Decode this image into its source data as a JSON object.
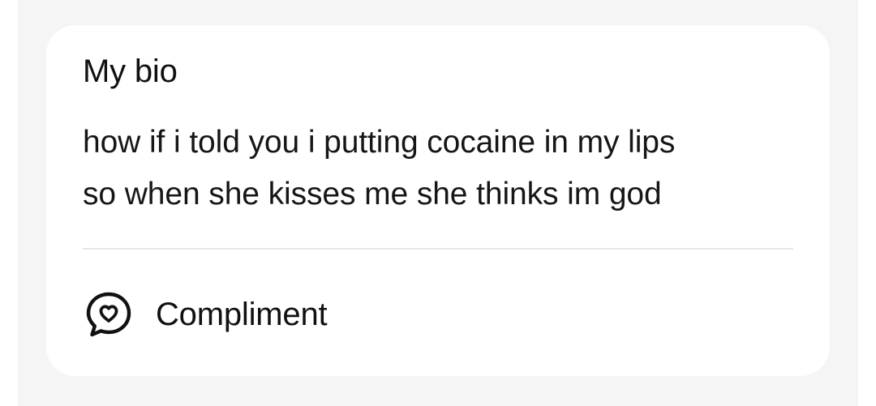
{
  "bio_card": {
    "title": "My bio",
    "text": "how if i told you i putting cocaine in my lips\nso when she kisses me she thinks im god"
  },
  "compliment": {
    "label": "Compliment",
    "icon": "heart-speech-bubble-icon"
  },
  "colors": {
    "page_background": "#f5f5f5",
    "card_background": "#ffffff",
    "text": "#111111",
    "divider": "#e6e6e6"
  }
}
